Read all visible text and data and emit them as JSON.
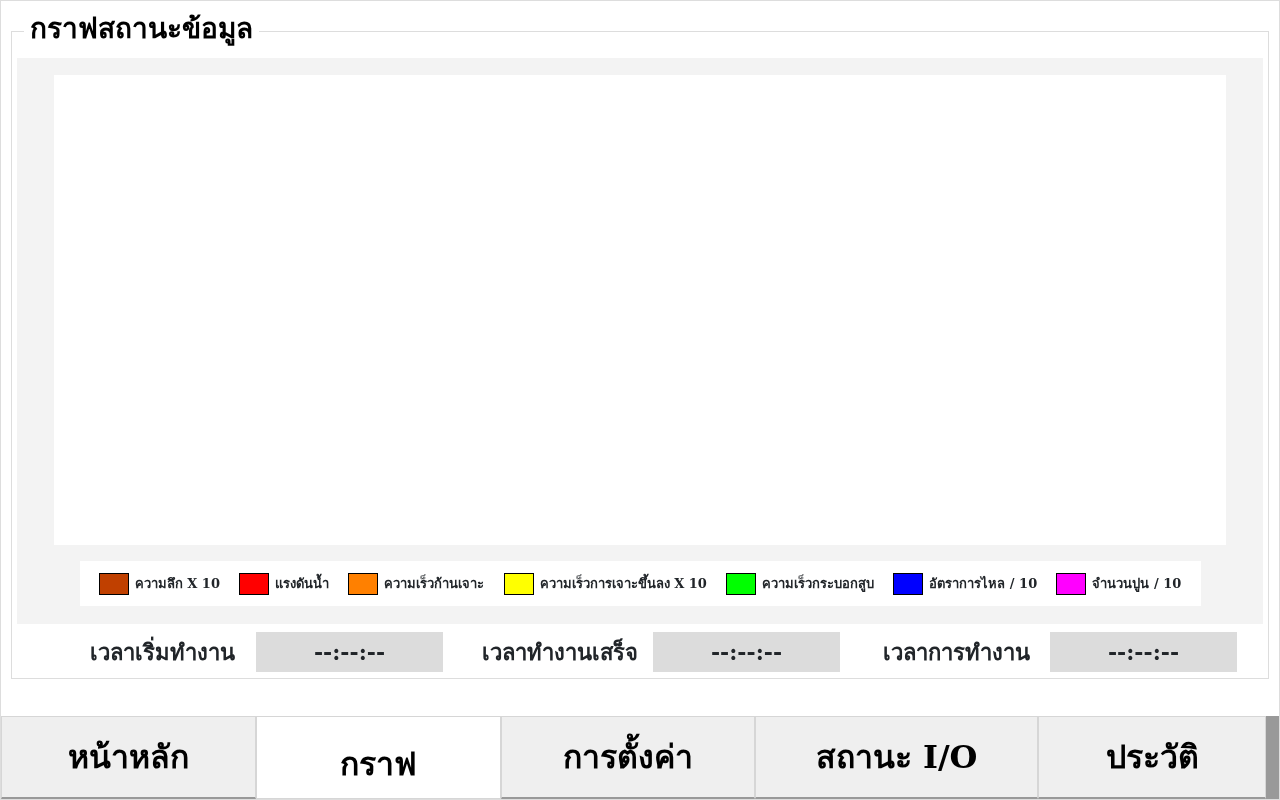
{
  "panel": {
    "title": "กราฟสถานะข้อมูล"
  },
  "chart": {
    "legend": [
      {
        "label": "ความลึก X 10",
        "color": "#c04000"
      },
      {
        "label": "แรงดันน้ำ",
        "color": "#ff0000"
      },
      {
        "label": "ความเร็วก้านเจาะ",
        "color": "#ff8000"
      },
      {
        "label": "ความเร็วการเจาะขึ้นลง X 10",
        "color": "#ffff00"
      },
      {
        "label": "ความเร็วกระบอกสูบ",
        "color": "#00ff00"
      },
      {
        "label": "อัตราการไหล / 10",
        "color": "#0000ff"
      },
      {
        "label": "จำนวนปูน / 10",
        "color": "#ff00ff"
      }
    ]
  },
  "times": [
    {
      "label": "เวลาเริ่มทำงาน",
      "value": "--:--:--"
    },
    {
      "label": "เวลาทำงานเสร็จ",
      "value": "--:--:--"
    },
    {
      "label": "เวลาการทำงาน",
      "value": "--:--:--"
    }
  ],
  "tabs": [
    {
      "label": "หน้าหลัก",
      "selected": false
    },
    {
      "label": "กราฟ",
      "selected": true
    },
    {
      "label": "การตั้งค่า",
      "selected": false
    },
    {
      "label": "สถานะ I/O",
      "selected": false
    },
    {
      "label": "ประวัติ",
      "selected": false
    }
  ]
}
